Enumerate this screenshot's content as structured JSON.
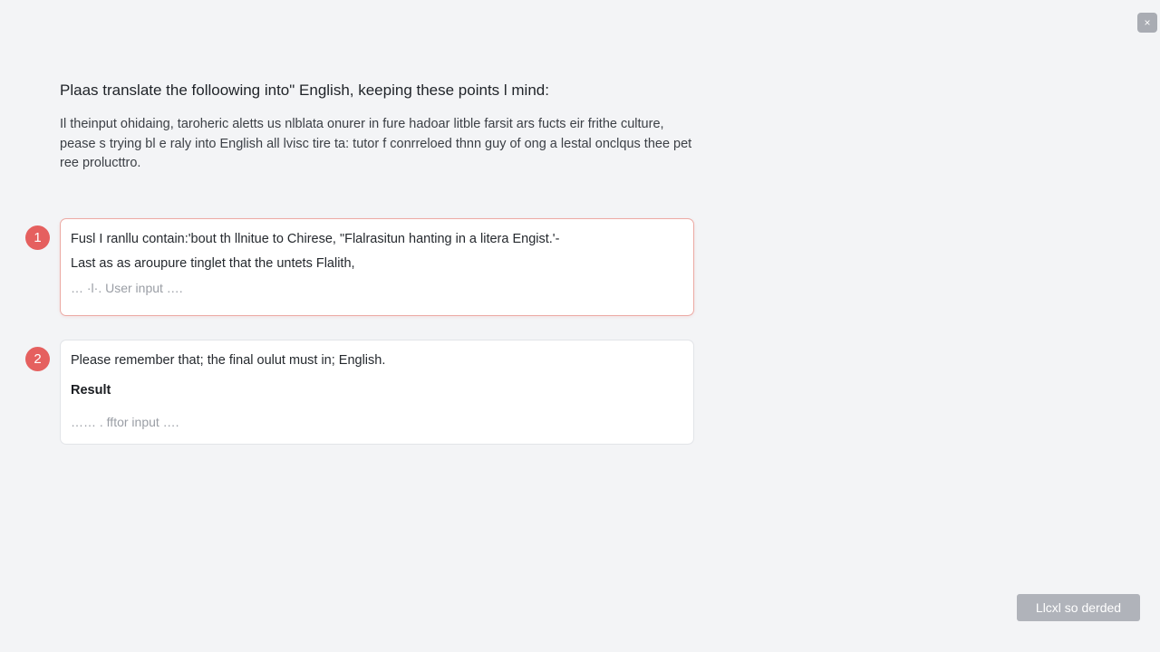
{
  "window": {
    "close_label": "×"
  },
  "instructions": {
    "heading": "Plaas translate the folloowing into\" English, keeping these points l mind:",
    "body": "Il theinput ohidaing, taroheric aletts us nlblata onurer in fure hadoar litble farsit ars fucts eir frithe culture, pease s trying bl e raly into English all lvisc tire ta: tutor f conrreloed thnn guy of ong a lestal onclqus thee pet ree prolucttro."
  },
  "steps": [
    {
      "number": "1",
      "line1": "Fusl I ranllu contain:'bout th llnitue to Chirese, \"Flalrasitun hanting in a litera Engist.'-",
      "line2": "Last as as aroupure tinglet that the untets Flalith,",
      "placeholder": "… ·l·. User input …."
    },
    {
      "number": "2",
      "line1": "Please  remember that; the final oulut must in; English.",
      "label": "Result",
      "placeholder": "…… . fftor input …."
    }
  ],
  "footer": {
    "submit_label": "Llcxl so derded"
  },
  "colors": {
    "accent": "#e5605f",
    "active_border": "#ecaaa4",
    "button_disabled": "#b0b3ba",
    "background": "#f3f4f6"
  }
}
